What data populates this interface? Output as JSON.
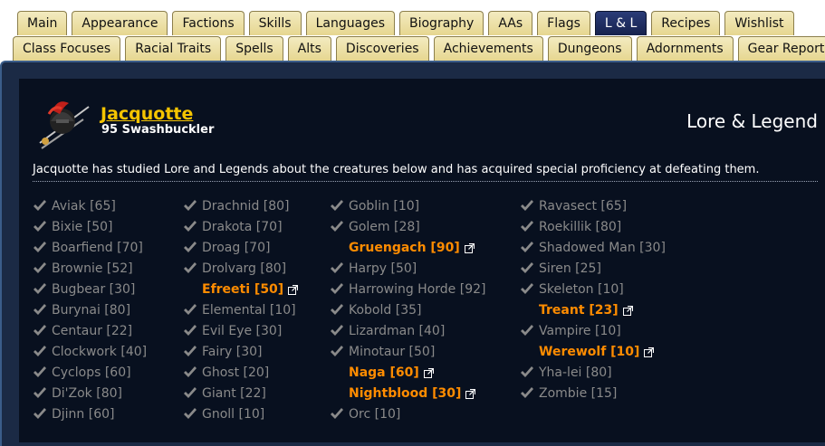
{
  "tabs_row1": [
    "Main",
    "Appearance",
    "Factions",
    "Skills",
    "Languages",
    "Biography",
    "AAs",
    "Flags",
    "L & L",
    "Recipes",
    "Wishlist"
  ],
  "tabs_row2": [
    "Class Focuses",
    "Racial Traits",
    "Spells",
    "Alts",
    "Discoveries",
    "Achievements",
    "Dungeons",
    "Adornments",
    "Gear Report"
  ],
  "active_tab": "L & L",
  "character": {
    "name": "Jacquotte",
    "subtitle": "95 Swashbuckler"
  },
  "section_title": "Lore & Legend",
  "intro": "Jacquotte has studied Lore and Legends about the creatures below and has acquired special proficiency at defeating them.",
  "colors": {
    "highlight": "#ff8c00",
    "completed": "#8a8a8a",
    "name": "#f5c400"
  },
  "columns": [
    [
      {
        "text": "Aviak [65]",
        "type": "check"
      },
      {
        "text": "Bixie [50]",
        "type": "check"
      },
      {
        "text": "Boarfiend [70]",
        "type": "check"
      },
      {
        "text": "Brownie [52]",
        "type": "check"
      },
      {
        "text": "Bugbear [30]",
        "type": "check"
      },
      {
        "text": "Burynai [80]",
        "type": "check"
      },
      {
        "text": "Centaur [22]",
        "type": "check"
      },
      {
        "text": "Clockwork [40]",
        "type": "check"
      },
      {
        "text": "Cyclops [60]",
        "type": "check"
      },
      {
        "text": "Di'Zok [80]",
        "type": "check"
      },
      {
        "text": "Djinn [60]",
        "type": "check"
      }
    ],
    [
      {
        "text": "Drachnid [80]",
        "type": "check"
      },
      {
        "text": "Drakota [70]",
        "type": "check"
      },
      {
        "text": "Droag [70]",
        "type": "check"
      },
      {
        "text": "Drolvarg [80]",
        "type": "check"
      },
      {
        "text": "Efreeti [50]",
        "type": "link"
      },
      {
        "text": "Elemental [10]",
        "type": "check"
      },
      {
        "text": "Evil Eye [30]",
        "type": "check"
      },
      {
        "text": "Fairy [30]",
        "type": "check"
      },
      {
        "text": "Ghost [20]",
        "type": "check"
      },
      {
        "text": "Giant [22]",
        "type": "check"
      },
      {
        "text": "Gnoll [10]",
        "type": "check"
      }
    ],
    [
      {
        "text": "Goblin [10]",
        "type": "check"
      },
      {
        "text": "Golem [28]",
        "type": "check"
      },
      {
        "text": "Gruengach [90]",
        "type": "link"
      },
      {
        "text": "Harpy [50]",
        "type": "check"
      },
      {
        "text": "Harrowing Horde [92]",
        "type": "check"
      },
      {
        "text": "Kobold [35]",
        "type": "check"
      },
      {
        "text": "Lizardman [40]",
        "type": "check"
      },
      {
        "text": "Minotaur [50]",
        "type": "check"
      },
      {
        "text": "Naga [60]",
        "type": "link"
      },
      {
        "text": "Nightblood [30]",
        "type": "link"
      },
      {
        "text": "Orc [10]",
        "type": "check"
      }
    ],
    [
      {
        "text": "Ravasect [65]",
        "type": "check"
      },
      {
        "text": "Roekillik [80]",
        "type": "check"
      },
      {
        "text": "Shadowed Man [30]",
        "type": "check"
      },
      {
        "text": "Siren [25]",
        "type": "check"
      },
      {
        "text": "Skeleton [10]",
        "type": "check"
      },
      {
        "text": "Treant [23]",
        "type": "link"
      },
      {
        "text": "Vampire [10]",
        "type": "check"
      },
      {
        "text": "Werewolf [10]",
        "type": "link"
      },
      {
        "text": "Yha-lei [80]",
        "type": "check"
      },
      {
        "text": "Zombie [15]",
        "type": "check"
      }
    ]
  ]
}
